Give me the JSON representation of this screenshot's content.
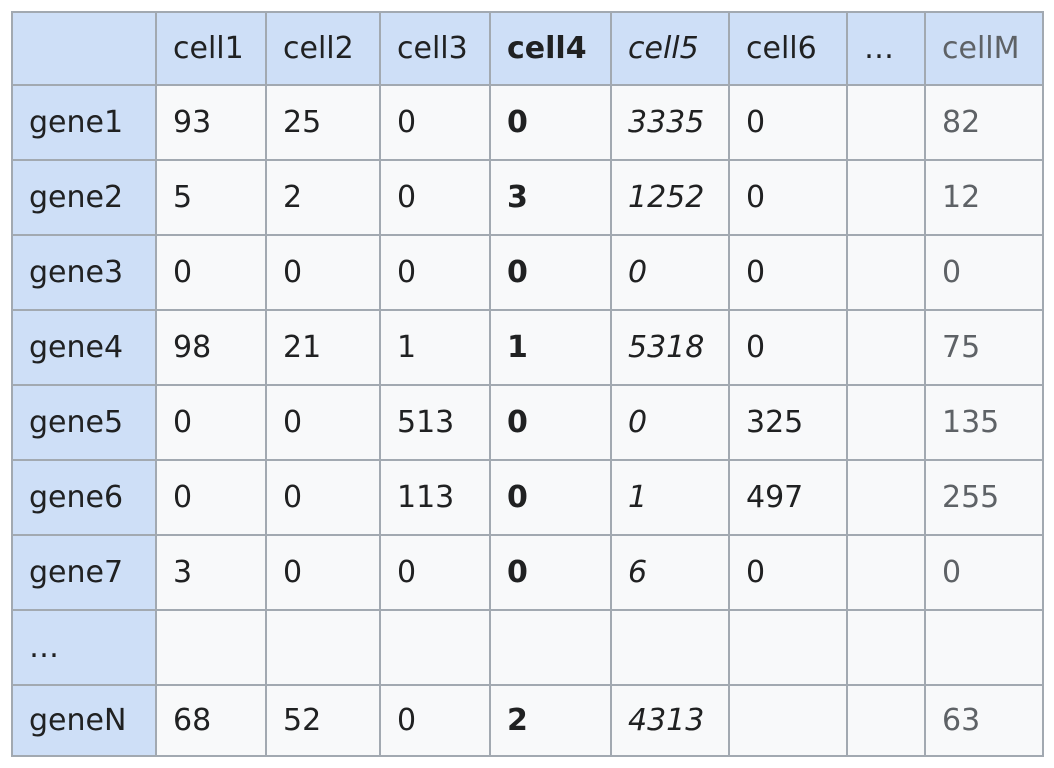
{
  "table": {
    "corner": "",
    "columns": [
      "cell1",
      "cell2",
      "cell3",
      "cell4",
      "cell5",
      "cell6",
      "…",
      "cellM"
    ],
    "rows": [
      {
        "label": "gene1",
        "cells": [
          "93",
          "25",
          "0",
          "0",
          "3335",
          "0",
          "",
          "82"
        ]
      },
      {
        "label": "gene2",
        "cells": [
          "5",
          "2",
          "0",
          "3",
          "1252",
          "0",
          "",
          "12"
        ]
      },
      {
        "label": "gene3",
        "cells": [
          "0",
          "0",
          "0",
          "0",
          "0",
          "0",
          "",
          "0"
        ]
      },
      {
        "label": "gene4",
        "cells": [
          "98",
          "21",
          "1",
          "1",
          "5318",
          "0",
          "",
          "75"
        ]
      },
      {
        "label": "gene5",
        "cells": [
          "0",
          "0",
          "513",
          "0",
          "0",
          "325",
          "",
          "135"
        ]
      },
      {
        "label": "gene6",
        "cells": [
          "0",
          "0",
          "113",
          "0",
          "1",
          "497",
          "",
          "255"
        ]
      },
      {
        "label": "gene7",
        "cells": [
          "3",
          "0",
          "0",
          "0",
          "6",
          "0",
          "",
          "0"
        ]
      },
      {
        "label": "…",
        "cells": [
          "",
          "",
          "",
          "",
          "",
          "",
          "",
          ""
        ]
      },
      {
        "label": "geneN",
        "cells": [
          "68",
          "52",
          "0",
          "2",
          "4313",
          "",
          "",
          "63"
        ]
      }
    ]
  }
}
